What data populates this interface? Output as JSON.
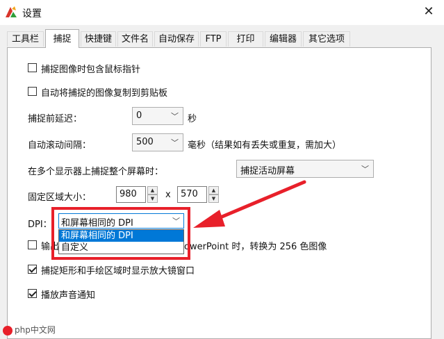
{
  "window": {
    "title": "设置",
    "close_glyph": "✕",
    "icon": "app-logo-icon"
  },
  "tabs": [
    "工具栏",
    "捕捉",
    "快捷键",
    "文件名",
    "自动保存",
    "FTP",
    "打印",
    "编辑器",
    "其它选项"
  ],
  "active_tab": "捕捉",
  "options": {
    "include_cursor": {
      "label": "捕捉图像时包含鼠标指针",
      "checked": false
    },
    "copy_clipboard": {
      "label": "自动将捕捉的图像复制到剪贴板",
      "checked": false
    },
    "delay": {
      "label": "捕捉前延迟：",
      "value": "0",
      "unit": "秒"
    },
    "scroll_interval": {
      "label": "自动滚动间隔：",
      "value": "500",
      "unit": "毫秒（结果如有丢失或重复，需加大）"
    },
    "multi_monitor": {
      "label": "在多个显示器上捕捉整个屏幕时：",
      "value": "捕捉活动屏幕"
    },
    "fixed_area": {
      "label": "固定区域大小：",
      "width": "980",
      "times": "x",
      "height": "570"
    },
    "dpi": {
      "label": "DPI：",
      "value": "和屏幕相同的 DPI",
      "options": [
        "和屏幕相同的 DPI",
        "自定义"
      ]
    },
    "output_256": {
      "label_visible_start": "输出",
      "label_visible_end": "owerPoint 时，转换为 256 色图像",
      "checked": false
    },
    "magnifier": {
      "label": "捕捉矩形和手绘区域时显示放大镜窗口",
      "checked": true
    },
    "sound": {
      "label": "播放声音通知",
      "checked": true
    }
  },
  "watermark": "php中文网",
  "colors": {
    "accent": "#0078d7",
    "highlight": "#e8202a"
  }
}
